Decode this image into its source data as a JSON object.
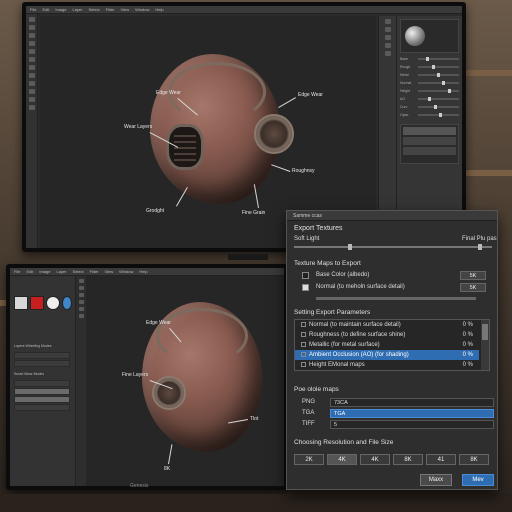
{
  "top_monitor": {
    "menu": [
      "File",
      "Edit",
      "Image",
      "Layer",
      "Select",
      "Filter",
      "View",
      "Window",
      "Help"
    ],
    "callouts": {
      "edge_wear": "Edge Wear",
      "wear_layers": "Wear Layers",
      "grunge": "Grodght",
      "fine_grain": "Fine Grain",
      "edge_wear_2": "Edge Wear",
      "roughness": "Roughnsy"
    },
    "panel_labels": [
      "Base",
      "Rough",
      "Metal",
      "Normal",
      "Height",
      "AO",
      "Curv",
      "Opac"
    ]
  },
  "bottom_monitor": {
    "brand": "Genesis",
    "swatch_colors": [
      "#d8d8d8",
      "#c71f1f",
      "#eeeeee",
      "#3f86c9"
    ],
    "layers_header": "Layers Wheeling Modes",
    "layers_header2": "Smart Wear Modes",
    "callouts": {
      "edge_wear": "Edge Wear",
      "fine_layers": "Fine Layers",
      "tool": "Tlot",
      "res": "8K"
    }
  },
  "top_brand": "",
  "dialog": {
    "window_title": "Samme ccas",
    "title": "Export Textures",
    "soft_light_label": "Soft Light",
    "final_pass_label": "Final Plu pas",
    "maps_section": "Texture Maps to Export",
    "maps": [
      {
        "label": "Base Color (albedo)",
        "size": "5K",
        "checked": false
      },
      {
        "label": "Normal (to meholn surface detail)",
        "size": "5K",
        "checked": true
      }
    ],
    "params_section": "Setting Export Parameters",
    "params": [
      {
        "label": "Normal (to maintain surface detail)",
        "value": "0 %",
        "selected": false
      },
      {
        "label": "Roughness (to define surface shine)",
        "value": "0 %",
        "selected": false
      },
      {
        "label": "Metallic (for metal surface)",
        "value": "0 %",
        "selected": false
      },
      {
        "label": "Ambient Occlusion (AO) (for shading)",
        "value": "0 %",
        "selected": true
      },
      {
        "label": "Height EMonal maps",
        "value": "0 %",
        "selected": false
      }
    ],
    "formats_section": "Poe olole maps",
    "formats": [
      {
        "label": "PNG",
        "value": "73CA",
        "selected": false
      },
      {
        "label": "TGA",
        "value": "TGA",
        "selected": true
      },
      {
        "label": "TIFF",
        "value": "5",
        "selected": false
      }
    ],
    "resolution_section": "Choosing Resolution and File Size",
    "resolutions": [
      "2K",
      "4K",
      "4K",
      "8K",
      "41",
      "8K"
    ],
    "cancel_label": "Maxx",
    "export_label": "Mev",
    "accent": "#2f6db3"
  }
}
